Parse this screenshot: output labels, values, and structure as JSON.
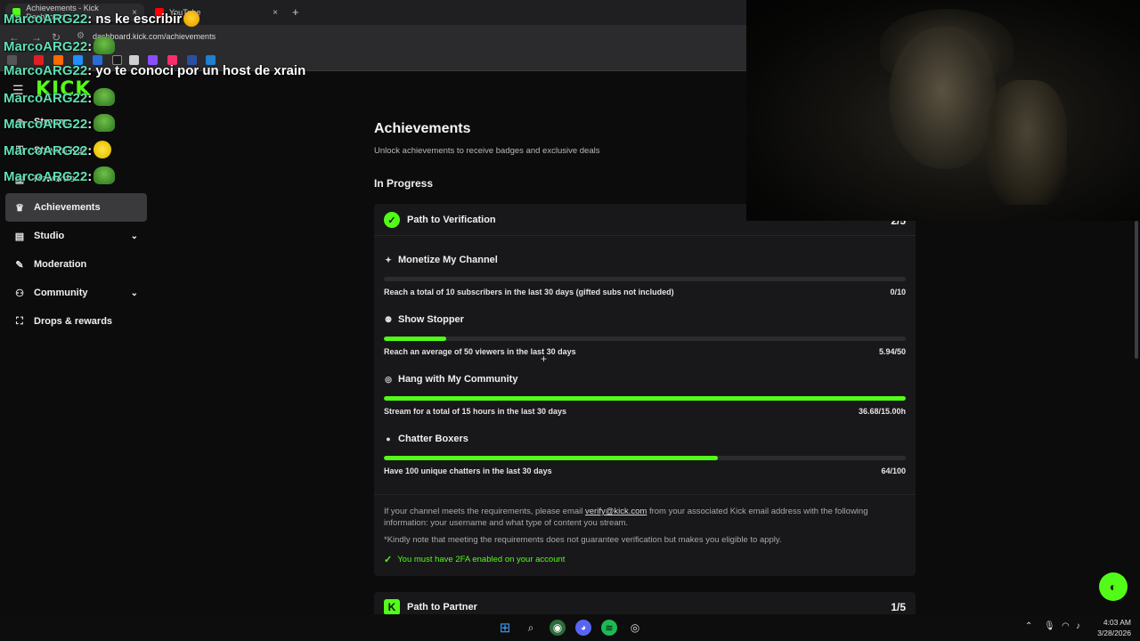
{
  "browser": {
    "tabs": [
      {
        "title": "Achievements - Kick Dashboard",
        "active": true
      },
      {
        "title": "YouTube",
        "active": false
      }
    ],
    "url": "dashboard.kick.com/achievements",
    "close_glyph": "×",
    "new_tab_glyph": "+"
  },
  "sidebar": {
    "logo": "KICK",
    "items": [
      {
        "label": "Stream",
        "icon": "broadcast-icon"
      },
      {
        "label": "Stream Key",
        "icon": "key-icon"
      },
      {
        "label": "Rewards",
        "icon": "gift-icon"
      },
      {
        "label": "Achievements",
        "icon": "trophy-icon",
        "active": true
      },
      {
        "label": "Studio",
        "icon": "studio-icon",
        "expandable": true
      },
      {
        "label": "Moderation",
        "icon": "wrench-icon"
      },
      {
        "label": "Community",
        "icon": "people-icon",
        "expandable": true
      },
      {
        "label": "Drops & rewards",
        "icon": "drops-icon"
      }
    ]
  },
  "page": {
    "title": "Achievements",
    "subtitle": "Unlock achievements to receive badges and exclusive deals",
    "section": "In Progress"
  },
  "verification": {
    "title": "Path to Verification",
    "count": "2/5",
    "tasks": [
      {
        "title": "Monetize My Channel",
        "icon": "sparkle-icon",
        "desc": "Reach a total of 10 subscribers in the last 30 days (gifted subs not included)",
        "value": "0/10",
        "progress": 0
      },
      {
        "title": "Show Stopper",
        "icon": "viewers-icon",
        "desc": "Reach an average of 50 viewers in the last 30 days",
        "value": "5.94/50",
        "progress": 0.119
      },
      {
        "title": "Hang with My Community",
        "icon": "signal-icon",
        "desc": "Stream for a total of 15 hours in the last 30 days",
        "value": "36.68/15.00h",
        "progress": 1
      },
      {
        "title": "Chatter Boxers",
        "icon": "chat-bubble-icon",
        "desc": "Have 100 unique chatters in the last 30 days",
        "value": "64/100",
        "progress": 0.64
      }
    ],
    "note_prefix": "If your channel meets the requirements, please email ",
    "note_email": "verify@kick.com",
    "note_suffix": " from your associated Kick email address with the following information: your username and what type of content you stream.",
    "disclaimer": "*Kindly note that meeting the requirements does not guarantee verification but makes you eligible to apply.",
    "twofa": "You must have 2FA enabled on your account"
  },
  "partner": {
    "title": "Path to Partner",
    "count": "1/5"
  },
  "chat": [
    {
      "user": "MarcoARG22",
      "msg": ": ns ke escribir",
      "emote": "thinking"
    },
    {
      "user": "MarcoARG22",
      "msg": ":",
      "emote": "pepe"
    },
    {
      "user": "MarcoARG22",
      "msg": ": yo te conoci por un host de xrain",
      "emote": ""
    },
    {
      "user": "MarcoARG22",
      "msg": ":",
      "emote": "pepe"
    },
    {
      "user": "MarcoARG22",
      "msg": ":",
      "emote": "pepe"
    },
    {
      "user": "MarcoARG22",
      "msg": ":",
      "emote": "neutral"
    },
    {
      "user": "MarcoARG22",
      "msg": ":",
      "emote": "pepe"
    }
  ],
  "taskbar": {
    "time": "4:03 AM",
    "date": "3/28/2026"
  },
  "colors": {
    "accent": "#53fc18",
    "background": "#0c0c0d",
    "card": "#18181a"
  }
}
